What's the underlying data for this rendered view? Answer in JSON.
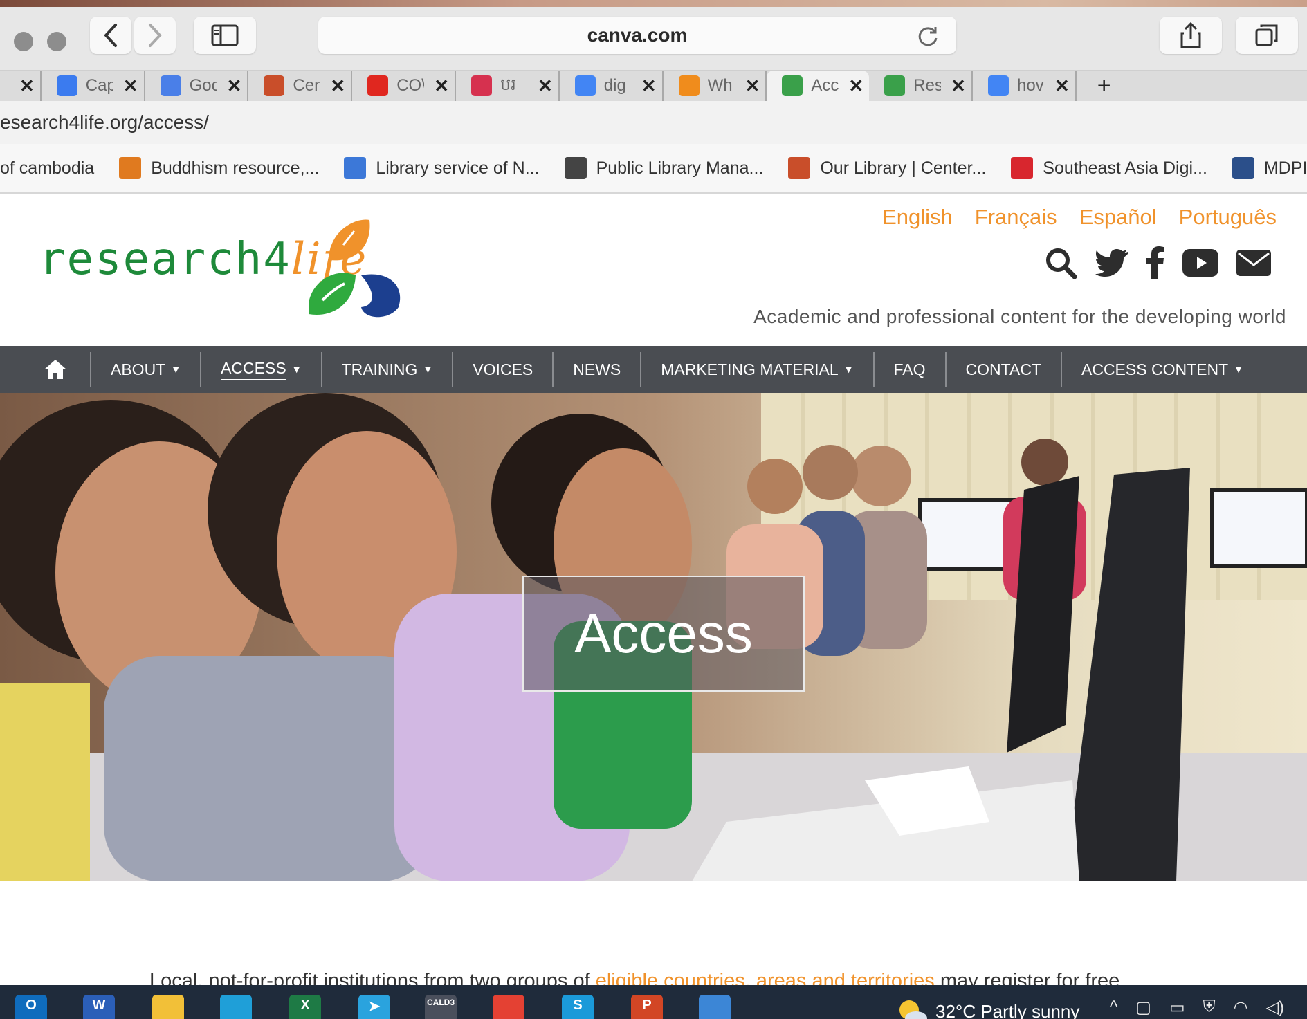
{
  "browser": {
    "url_display": "canva.com",
    "tabs": [
      {
        "label": "",
        "icon": "blank-tab-icon",
        "color": "#dcdcdc"
      },
      {
        "label": "Cap",
        "icon": "docs-icon",
        "color": "#3b7bef"
      },
      {
        "label": "Goo",
        "icon": "translate-icon",
        "color": "#4a7fe8"
      },
      {
        "label": "Cen",
        "icon": "library-icon",
        "color": "#c94e2a"
      },
      {
        "label": "CO\\",
        "icon": "maple-leaf-icon",
        "color": "#e0271f"
      },
      {
        "label": "បរ",
        "icon": "news-icon",
        "color": "#d6314f"
      },
      {
        "label": "dig",
        "icon": "google-icon",
        "color": "#4285f4"
      },
      {
        "label": "Wh",
        "icon": "question-icon",
        "color": "#f08c1c"
      },
      {
        "label": "Acc",
        "icon": "research4life-icon",
        "color": "#3aa04a"
      },
      {
        "label": "Res",
        "icon": "research4life-icon",
        "color": "#3aa04a"
      },
      {
        "label": "hov",
        "icon": "google-icon",
        "color": "#4285f4"
      }
    ],
    "new_tab_label": "+",
    "address": "esearch4life.org/access/",
    "bookmarks": [
      {
        "label": "of cambodia",
        "icon": "",
        "color": ""
      },
      {
        "label": "Buddhism resource,...",
        "icon": "buddhism-icon",
        "color": "#e07a1f"
      },
      {
        "label": "Library service of N...",
        "icon": "library-service-icon",
        "color": "#3c78d8"
      },
      {
        "label": "Public Library Mana...",
        "icon": "public-library-icon",
        "color": "#444444"
      },
      {
        "label": "Our Library | Center...",
        "icon": "center-library-icon",
        "color": "#c94e2a"
      },
      {
        "label": "Southeast Asia Digi...",
        "icon": "niu-icon",
        "color": "#d8262e"
      },
      {
        "label": "MDPI | Journals",
        "icon": "unlock-icon",
        "color": "#2b4f8a"
      }
    ]
  },
  "site": {
    "logo_text_main": "research4",
    "logo_text_life": "life",
    "languages": [
      "English",
      "Français",
      "Español",
      "Português"
    ],
    "tagline": "Academic and professional content for the developing world",
    "social_icons": [
      "search-icon",
      "twitter-icon",
      "facebook-icon",
      "youtube-icon",
      "envelope-icon"
    ],
    "nav": [
      {
        "label": "",
        "icon": "home-icon",
        "dropdown": false,
        "current": false
      },
      {
        "label": "ABOUT",
        "dropdown": true,
        "current": false
      },
      {
        "label": "ACCESS",
        "dropdown": true,
        "current": true
      },
      {
        "label": "TRAINING",
        "dropdown": true,
        "current": false
      },
      {
        "label": "VOICES",
        "dropdown": false,
        "current": false
      },
      {
        "label": "NEWS",
        "dropdown": false,
        "current": false
      },
      {
        "label": "MARKETING MATERIAL",
        "dropdown": true,
        "current": false
      },
      {
        "label": "FAQ",
        "dropdown": false,
        "current": false
      },
      {
        "label": "CONTACT",
        "dropdown": false,
        "current": false
      },
      {
        "label": "ACCESS CONTENT",
        "dropdown": true,
        "current": false
      }
    ],
    "hero_title": "Access",
    "body_prefix": "Local, not-for-profit institutions from two groups of ",
    "body_link": "eligible countries, areas and territories",
    "body_suffix": " may register for free",
    "accent_color": "#f0922b",
    "brand_green": "#1e8a3a",
    "nav_bg": "#4a4d52"
  },
  "taskbar": {
    "apps": [
      {
        "name": "outlook-icon",
        "glyph": "O",
        "color": "#0f6cbd"
      },
      {
        "name": "word-icon",
        "glyph": "W",
        "color": "#2b5fb8"
      },
      {
        "name": "file-explorer-icon",
        "glyph": "",
        "color": "#f2c038"
      },
      {
        "name": "edge-icon",
        "glyph": "",
        "color": "#1f9fd8"
      },
      {
        "name": "excel-icon",
        "glyph": "X",
        "color": "#1e7a45"
      },
      {
        "name": "telegram-icon",
        "glyph": "➤",
        "color": "#2aa3de"
      },
      {
        "name": "cald3-icon",
        "glyph": "CALD3",
        "color": "#4a4f5c"
      },
      {
        "name": "chrome-icon",
        "glyph": "",
        "color": "#e44133"
      },
      {
        "name": "skype-icon",
        "glyph": "S",
        "color": "#1b9ad9"
      },
      {
        "name": "powerpoint-icon",
        "glyph": "P",
        "color": "#d24625"
      },
      {
        "name": "photos-icon",
        "glyph": "",
        "color": "#3c86d6"
      }
    ],
    "weather_text": "32°C  Partly sunny"
  }
}
